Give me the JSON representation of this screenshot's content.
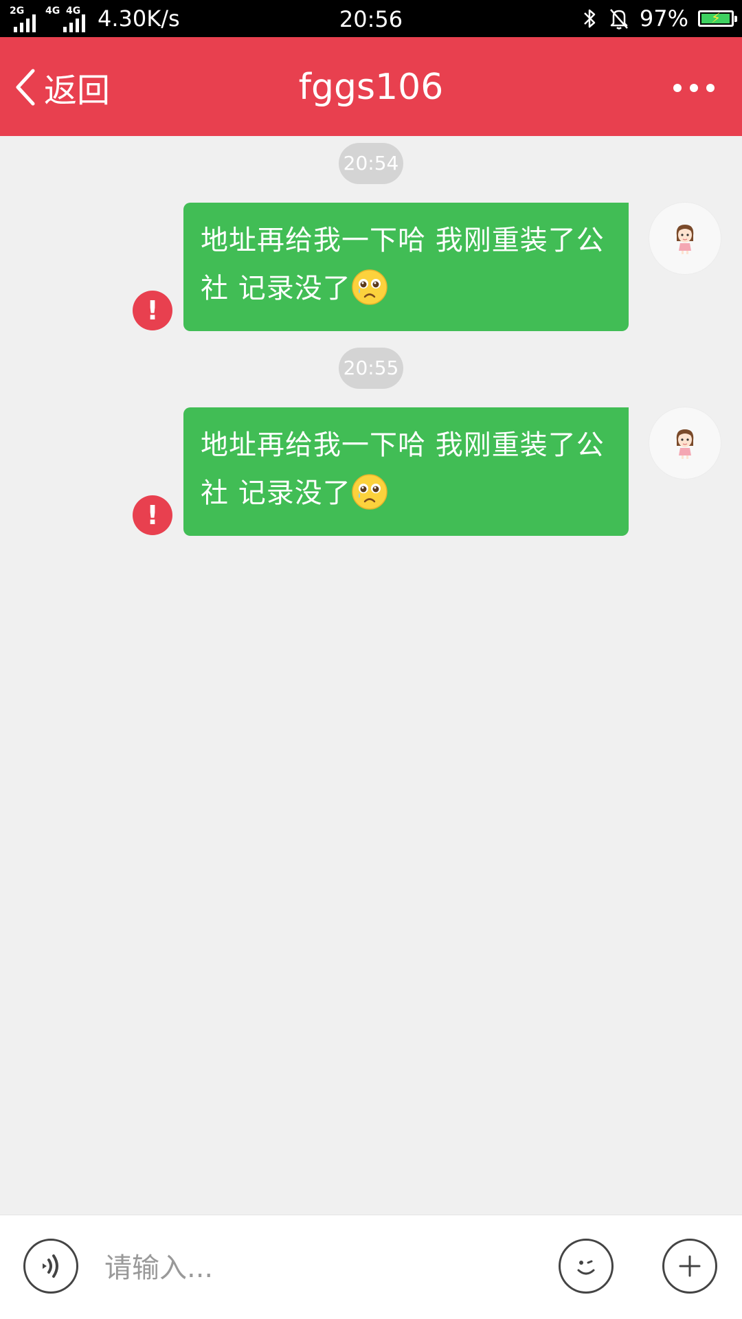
{
  "status_bar": {
    "net1": "2G",
    "net2": "4G",
    "net3": "4G",
    "speed": "4.30K/s",
    "time": "20:56",
    "battery": "97%",
    "battery_level": 0.97,
    "icons": [
      "signal-icon",
      "bluetooth-icon",
      "mute-bell-icon",
      "battery-icon"
    ]
  },
  "header": {
    "back_label": "返回",
    "title": "fggs106",
    "more_icon": "more-dots-icon"
  },
  "messages": [
    {
      "time": "20:54",
      "line1": "地址再给我一下哈 我刚重装了公",
      "line2": "社 记录没了",
      "emoji": "crying-face-emoji",
      "status_icon": "!",
      "color": "#41bd55"
    },
    {
      "time": "20:55",
      "line1": "地址再给我一下哈 我刚重装了公",
      "line2": "社 记录没了",
      "emoji": "crying-face-emoji",
      "status_icon": "!",
      "color": "#41bd55"
    }
  ],
  "input_bar": {
    "placeholder": "请输入...",
    "value": "",
    "voice_icon": "voice-icon",
    "emoji_icon": "smiley-icon",
    "plus_icon": "plus-icon"
  },
  "colors": {
    "accent": "#e8404f",
    "bubble": "#41bd55",
    "background": "#f0f0f0"
  }
}
